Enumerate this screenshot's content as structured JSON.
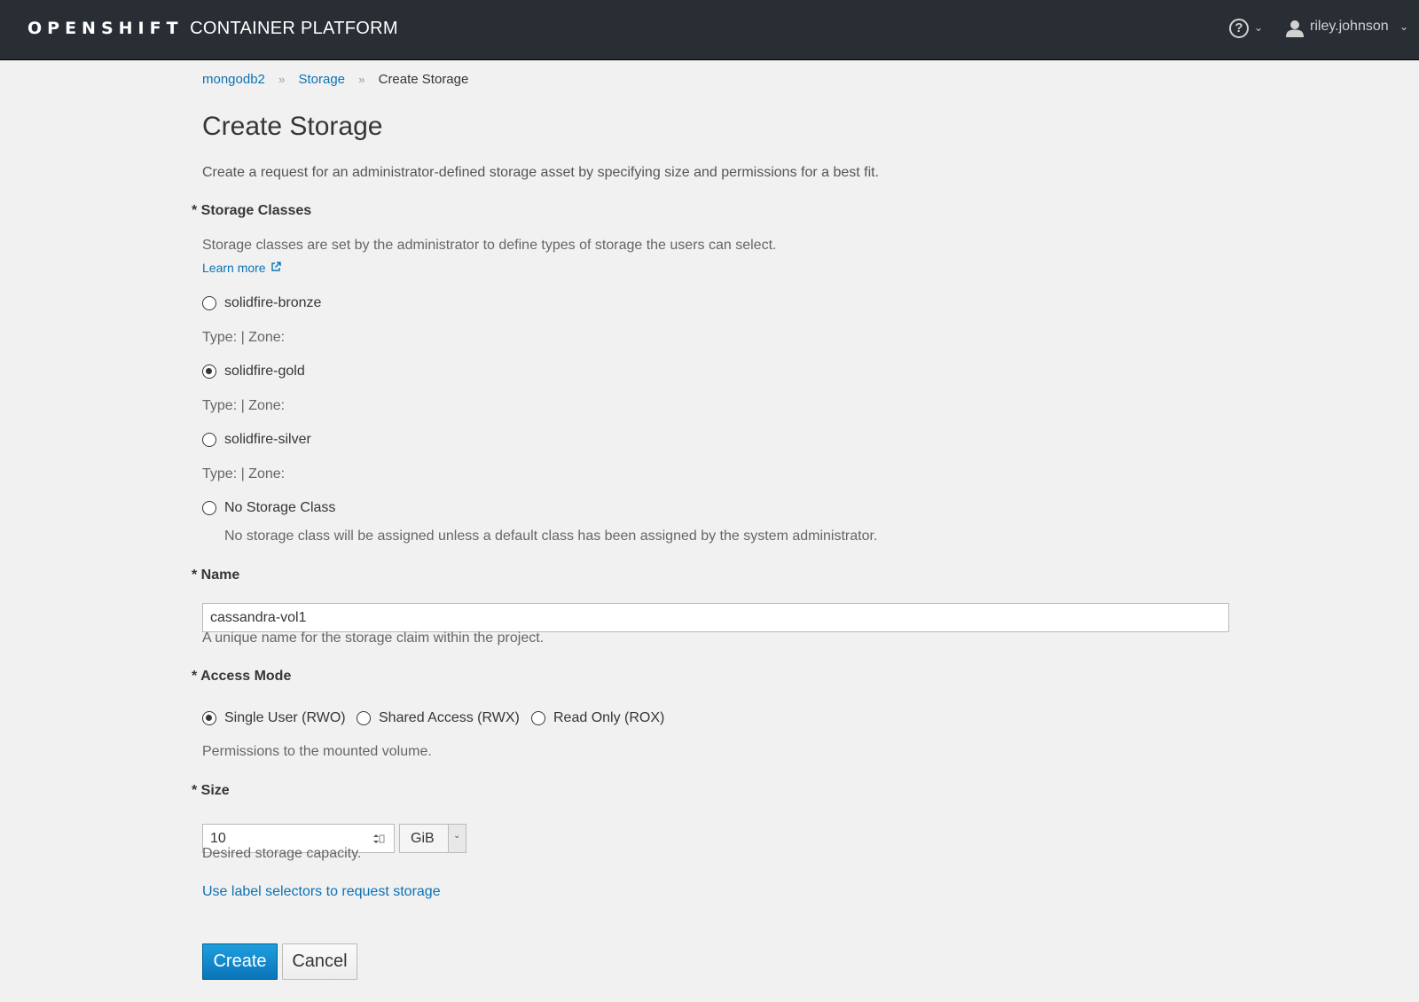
{
  "header": {
    "brand_bold": "OPENSHIFT",
    "brand_light": "CONTAINER PLATFORM",
    "help_icon": "question-circle-icon",
    "user_name": "riley.johnson"
  },
  "breadcrumb": {
    "items": [
      "mongodb2",
      "Storage"
    ],
    "current": "Create Storage"
  },
  "page": {
    "title": "Create Storage",
    "intro": "Create a request for an administrator-defined storage asset by specifying size and permissions for a best fit."
  },
  "storage_classes": {
    "label": "* Storage Classes",
    "help": "Storage classes are set by the administrator to define types of storage the users can select.",
    "learn_more": "Learn more",
    "options": [
      {
        "name": "solidfire-bronze",
        "meta": "Type: | Zone:",
        "selected": false
      },
      {
        "name": "solidfire-gold",
        "meta": "Type: | Zone:",
        "selected": true
      },
      {
        "name": "solidfire-silver",
        "meta": "Type: | Zone:",
        "selected": false
      }
    ],
    "none_option": "No Storage Class",
    "none_help": "No storage class will be assigned unless a default class has been assigned by the system administrator."
  },
  "name_field": {
    "label": "* Name",
    "value": "cassandra-vol1",
    "help": "A unique name for the storage claim within the project."
  },
  "access_mode": {
    "label": "* Access Mode",
    "options": [
      {
        "name": "Single User (RWO)",
        "selected": true
      },
      {
        "name": "Shared Access (RWX)",
        "selected": false
      },
      {
        "name": "Read Only (ROX)",
        "selected": false
      }
    ],
    "help": "Permissions to the mounted volume."
  },
  "size": {
    "label": "* Size",
    "value": "10",
    "unit": "GiB",
    "help": "Desired storage capacity."
  },
  "label_selector_link": "Use label selectors to request storage",
  "buttons": {
    "create": "Create",
    "cancel": "Cancel"
  },
  "colors": {
    "topbar": "#292e34",
    "link": "#0b72b5",
    "primary": "#0a74b8",
    "background": "#f1f1f1"
  }
}
